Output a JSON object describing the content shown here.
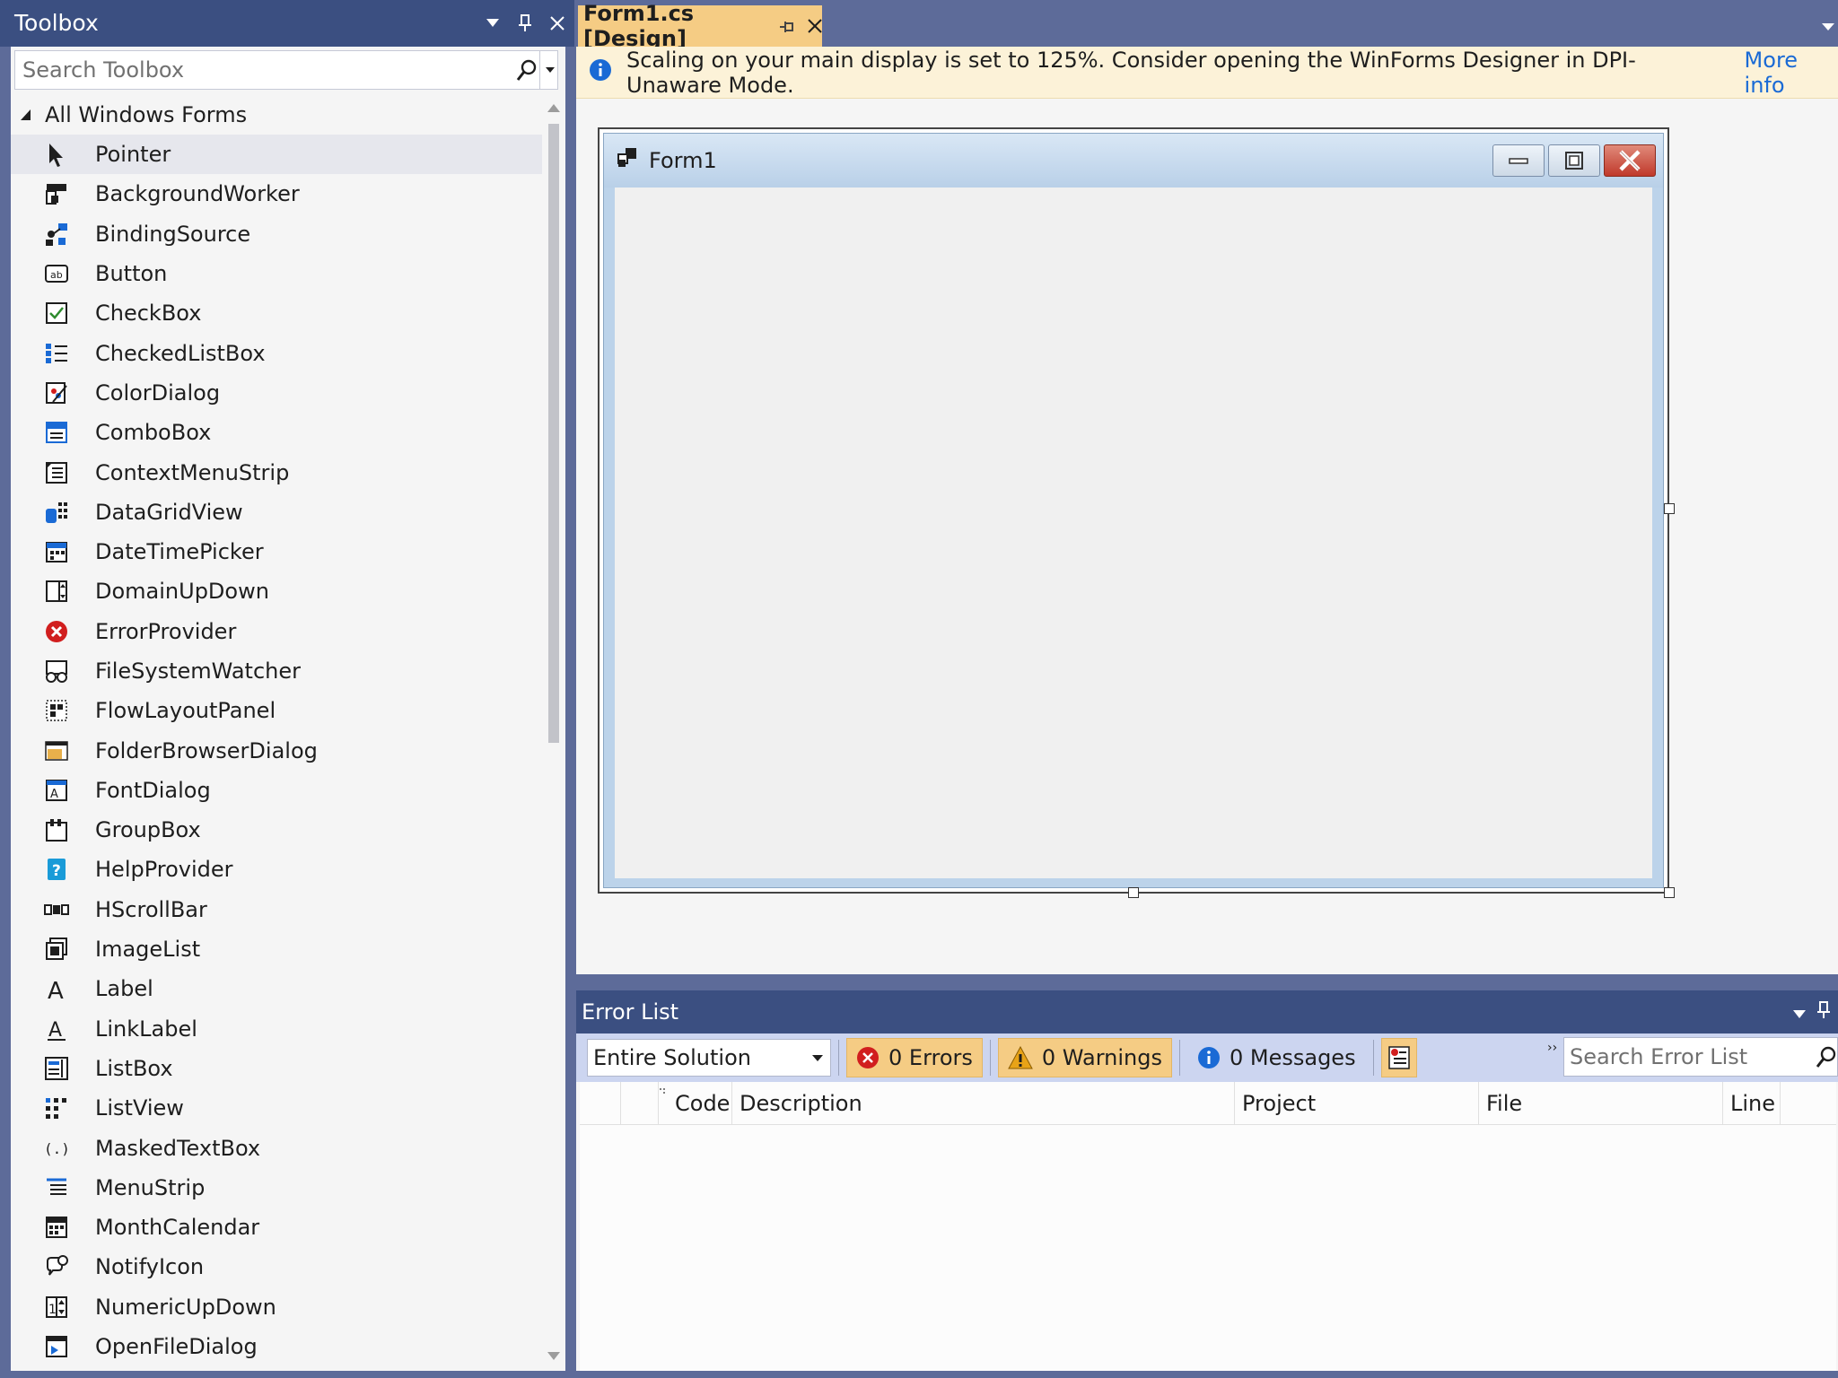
{
  "toolbox": {
    "title": "Toolbox",
    "search_placeholder": "Search Toolbox",
    "group": "All Windows Forms",
    "items": [
      {
        "label": "Pointer",
        "icon": "pointer-icon"
      },
      {
        "label": "BackgroundWorker",
        "icon": "background-worker-icon"
      },
      {
        "label": "BindingSource",
        "icon": "binding-source-icon"
      },
      {
        "label": "Button",
        "icon": "button-icon"
      },
      {
        "label": "CheckBox",
        "icon": "checkbox-icon"
      },
      {
        "label": "CheckedListBox",
        "icon": "checked-listbox-icon"
      },
      {
        "label": "ColorDialog",
        "icon": "color-dialog-icon"
      },
      {
        "label": "ComboBox",
        "icon": "combobox-icon"
      },
      {
        "label": "ContextMenuStrip",
        "icon": "context-menu-strip-icon"
      },
      {
        "label": "DataGridView",
        "icon": "datagridview-icon"
      },
      {
        "label": "DateTimePicker",
        "icon": "datetime-picker-icon"
      },
      {
        "label": "DomainUpDown",
        "icon": "domain-updown-icon"
      },
      {
        "label": "ErrorProvider",
        "icon": "error-provider-icon"
      },
      {
        "label": "FileSystemWatcher",
        "icon": "filesystem-watcher-icon"
      },
      {
        "label": "FlowLayoutPanel",
        "icon": "flow-layout-panel-icon"
      },
      {
        "label": "FolderBrowserDialog",
        "icon": "folder-browser-dialog-icon"
      },
      {
        "label": "FontDialog",
        "icon": "font-dialog-icon"
      },
      {
        "label": "GroupBox",
        "icon": "groupbox-icon"
      },
      {
        "label": "HelpProvider",
        "icon": "help-provider-icon"
      },
      {
        "label": "HScrollBar",
        "icon": "hscrollbar-icon"
      },
      {
        "label": "ImageList",
        "icon": "imagelist-icon"
      },
      {
        "label": "Label",
        "icon": "label-icon"
      },
      {
        "label": "LinkLabel",
        "icon": "linklabel-icon"
      },
      {
        "label": "ListBox",
        "icon": "listbox-icon"
      },
      {
        "label": "ListView",
        "icon": "listview-icon"
      },
      {
        "label": "MaskedTextBox",
        "icon": "masked-textbox-icon"
      },
      {
        "label": "MenuStrip",
        "icon": "menustrip-icon"
      },
      {
        "label": "MonthCalendar",
        "icon": "month-calendar-icon"
      },
      {
        "label": "NotifyIcon",
        "icon": "notify-icon-icon"
      },
      {
        "label": "NumericUpDown",
        "icon": "numeric-updown-icon"
      },
      {
        "label": "OpenFileDialog",
        "icon": "open-file-dialog-icon"
      }
    ]
  },
  "document": {
    "tab_title": "Form1.cs [Design]",
    "infobar_message": "Scaling on your main display is set to 125%. Consider opening the WinForms Designer in DPI-Unaware Mode.",
    "infobar_link": "More info",
    "form_title": "Form1"
  },
  "error_list": {
    "title": "Error List",
    "scope": "Entire Solution",
    "errors": "0 Errors",
    "warnings": "0 Warnings",
    "messages": "0 Messages",
    "search_placeholder": "Search Error List",
    "columns": [
      "Code",
      "Description",
      "Project",
      "File",
      "Line"
    ]
  },
  "colors": {
    "frame": "#5d6b99",
    "titlebar": "#3b4f81",
    "active_tab": "#f5cc84",
    "infobar": "#fcf2d8",
    "link": "#1a6ad5"
  }
}
